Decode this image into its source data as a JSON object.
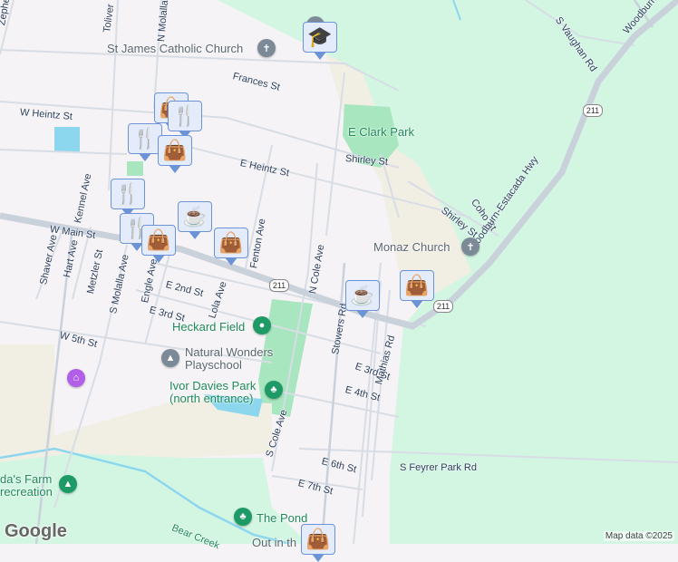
{
  "streets": {
    "zephyr": "Zephe",
    "toliver": "Toliver",
    "n_molalla": "N Molalla",
    "frances": "Frances St",
    "w_heintz": "W Heintz St",
    "e_heintz": "E Heintz St",
    "shirley1": "Shirley St",
    "shirley2": "Shirley St",
    "coho": "Coho St",
    "kennel": "Kennel Ave",
    "w_main": "W Main St",
    "shaver": "Shaver Ave",
    "hart": "Hart Ave",
    "metzler": "Metzler St",
    "s_molalla": "S Molalla Ave",
    "engle": "Engle Ave",
    "lola": "Lola Ave",
    "fenton": "Fenton Ave",
    "n_cole": "N Cole Ave",
    "e2nd": "E 2nd St",
    "e3rd": "E 3rd St",
    "w5th": "W 5th St",
    "stowers": "Stowers Rd",
    "e3rd_b": "E 3rd St",
    "e4th": "E 4th St",
    "mathias": "Mathias Rd",
    "s_cole": "S Cole Ave",
    "e6th": "E 6th St",
    "e7th": "E 7th St",
    "s_feyrer": "S Feyrer Park Rd",
    "woodburn": "Woodburn-Estacada Hwy",
    "woodburn_top": "Woodburn-E",
    "s_vaughan": "S Vaughan Rd",
    "bear_creek": "Bear Creek",
    "hwy211": "211"
  },
  "pois": {
    "st_james": "St James Catholic Church",
    "e_clark_park": "E Clark Park",
    "monaz": "Monaz Church",
    "heckard": "Heckard Field",
    "natural_wonders": "Natural Wonders\nPlayschool",
    "ivor_davies": "Ivor Davies Park\n(north entrance)",
    "farm": "da's Farm\nrecreation",
    "pond": "The Pond",
    "out_in": "Out in th"
  },
  "markers": [
    {
      "type": "school"
    },
    {
      "type": "shopping"
    },
    {
      "type": "restaurant"
    },
    {
      "type": "restaurant"
    },
    {
      "type": "shopping"
    },
    {
      "type": "restaurant"
    },
    {
      "type": "cafe"
    },
    {
      "type": "restaurant"
    },
    {
      "type": "shopping"
    },
    {
      "type": "shopping"
    },
    {
      "type": "cafe"
    },
    {
      "type": "shopping"
    },
    {
      "type": "shopping"
    }
  ],
  "footer": {
    "google": "Google",
    "attribution": "Map data ©2025"
  },
  "colors": {
    "marker_bg": "#e4ecfc",
    "marker_border": "#6b93d6",
    "marker_icon": "#0b4267",
    "park": "#a8e6bf",
    "green_area": "#d3f6e3",
    "road": "#c9d1db"
  }
}
